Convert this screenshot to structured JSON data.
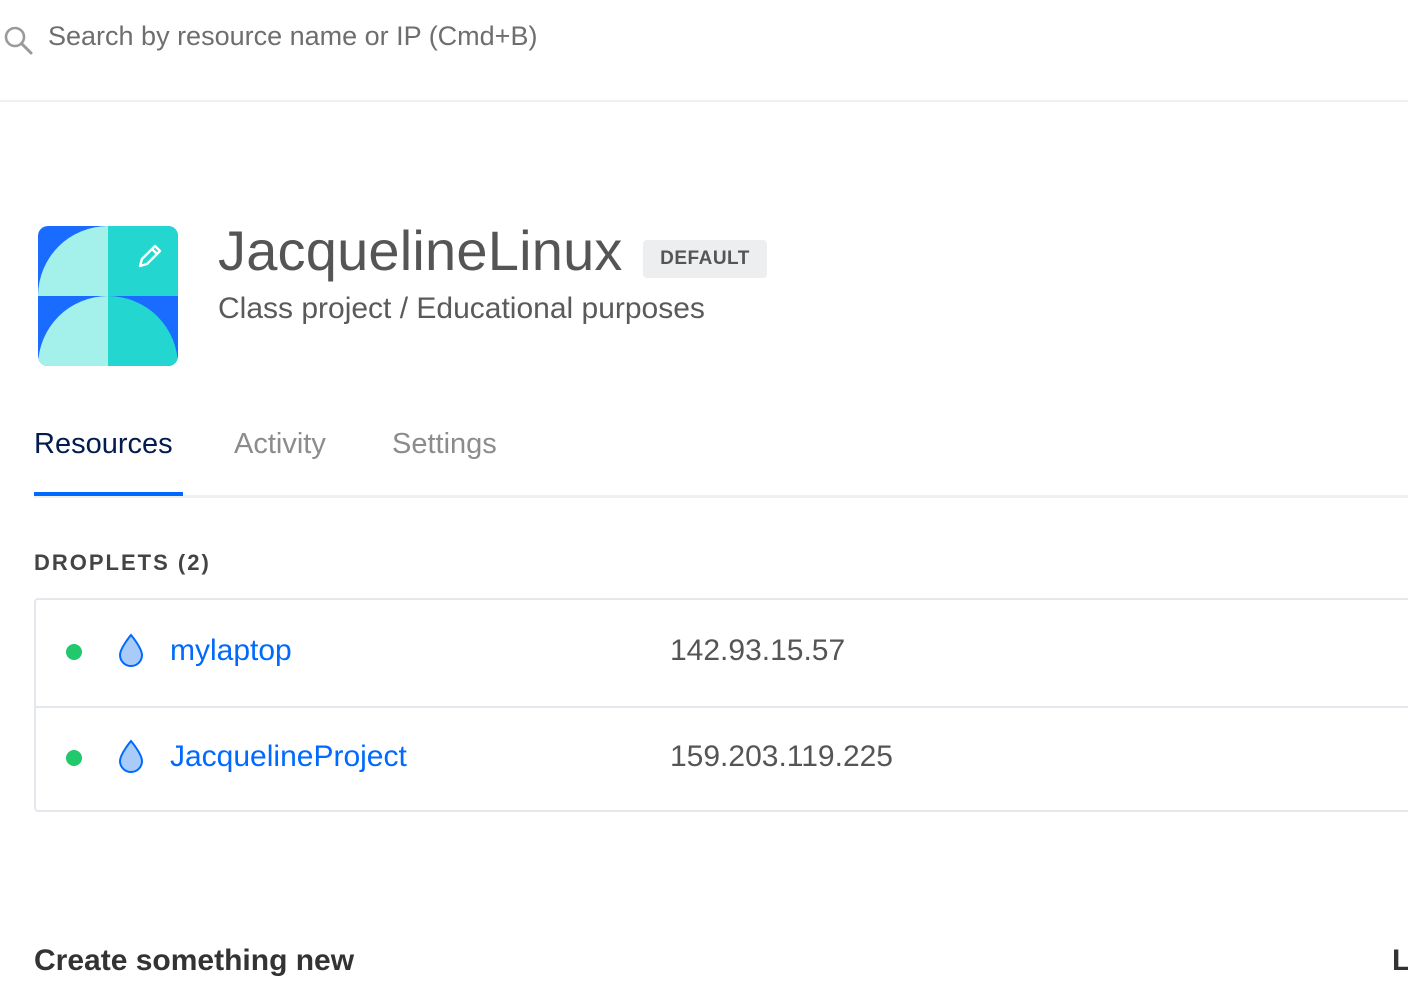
{
  "search": {
    "placeholder": "Search by resource name or IP (Cmd+B)",
    "icon": "search-icon"
  },
  "project": {
    "name": "JacquelineLinux",
    "badge": "DEFAULT",
    "description": "Class project / Educational purposes",
    "logo_icon": "project-logo-icon",
    "edit_icon": "pencil-icon",
    "colors": {
      "logo_blue": "#1a6bff",
      "logo_teal": "#24d6d0",
      "logo_light": "#a4f0ea"
    }
  },
  "tabs": [
    {
      "label": "Resources",
      "active": true
    },
    {
      "label": "Activity",
      "active": false
    },
    {
      "label": "Settings",
      "active": false
    }
  ],
  "droplets": {
    "title": "DROPLETS (2)",
    "items": [
      {
        "name": "mylaptop",
        "ip": "142.93.15.57",
        "status": "running",
        "status_color": "#21c86c",
        "icon": "droplet-icon"
      },
      {
        "name": "JacquelineProject",
        "ip": "159.203.119.225",
        "status": "running",
        "status_color": "#21c86c",
        "icon": "droplet-icon"
      }
    ]
  },
  "create": {
    "title": "Create something new",
    "right_heading": "L"
  },
  "accent_color": "#0069ff"
}
